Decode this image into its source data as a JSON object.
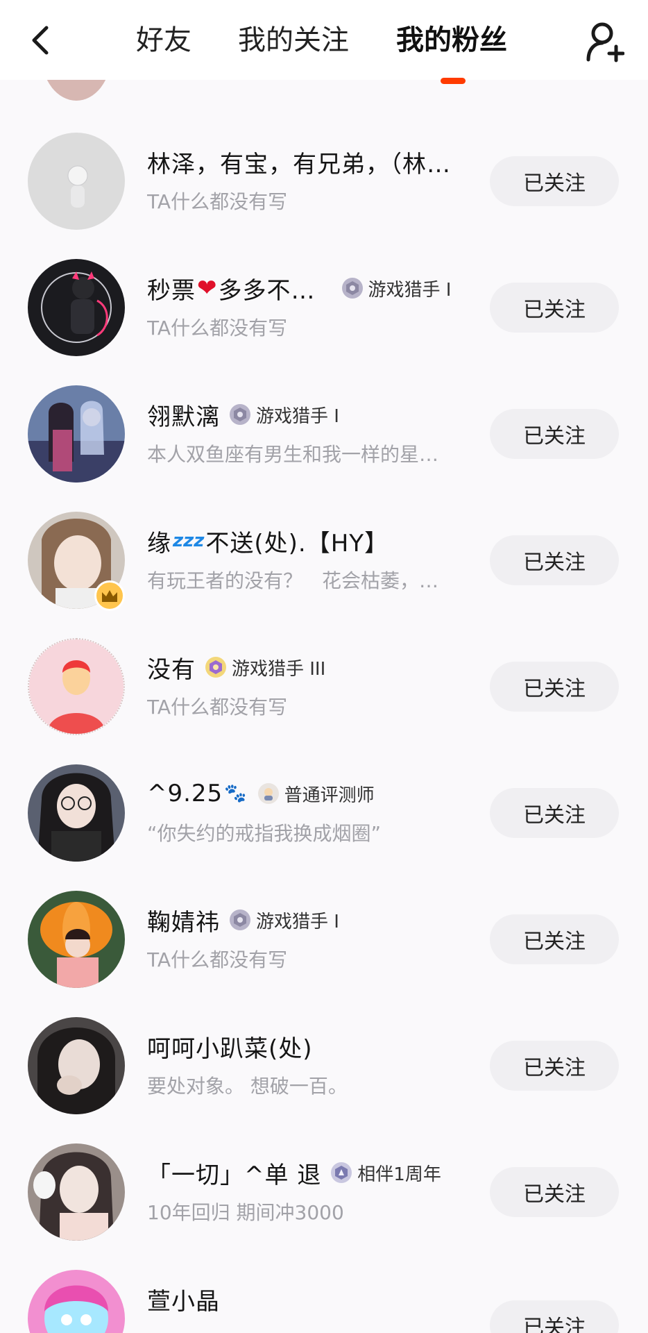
{
  "header": {
    "tabs": [
      "好友",
      "我的关注",
      "我的粉丝"
    ],
    "active_tab": "我的粉丝"
  },
  "colors": {
    "accent": "#ff3b00",
    "button_bg": "#f0eff2",
    "secondary_text": "#a2a2a8"
  },
  "fans": [
    {
      "name_before": "林泽，有宝，有兄弟，（林…",
      "name_after": "",
      "badge": "",
      "bio": "TA什么都没有写",
      "button": "已关注"
    },
    {
      "name_before": "秒票",
      "emoji": "❤",
      "name_after": "多多不…",
      "badge": "游戏猎手 I",
      "bio": "TA什么都没有写",
      "button": "已关注"
    },
    {
      "name_before": "翎默漓",
      "name_after": "",
      "badge": "游戏猎手 I",
      "bio": "本人双鱼座有男生和我一样的星…",
      "button": "已关注"
    },
    {
      "name_before": "缘",
      "emoji": "zzz",
      "name_after": "不送(处).【HY】",
      "badge": "",
      "bio": "有玩王者的没有？　花会枯萎，…",
      "button": "已关注"
    },
    {
      "name_before": "没有",
      "name_after": "",
      "badge": "游戏猎手 III",
      "bio": "TA什么都没有写",
      "button": "已关注"
    },
    {
      "name_before": "^9.25",
      "emoji": "🐾",
      "name_after": "",
      "badge": "普通评测师",
      "bio": "“你失约的戒指我换成烟圈”",
      "button": "已关注"
    },
    {
      "name_before": "鞠婧祎",
      "name_after": "",
      "badge": "游戏猎手 I",
      "bio": "TA什么都没有写",
      "button": "已关注"
    },
    {
      "name_before": "呵呵小趴菜(处)",
      "name_after": "",
      "badge": "",
      "bio": "要处对象。 想破一百。",
      "button": "已关注"
    },
    {
      "name_before": "「一切」^单  退",
      "name_after": "",
      "badge": "相伴1周年",
      "bio": "10年回归  期间冲3000",
      "button": "已关注"
    },
    {
      "name_before": "萱小晶",
      "name_after": "",
      "badge": "",
      "bio": "",
      "button": "已关注"
    }
  ]
}
